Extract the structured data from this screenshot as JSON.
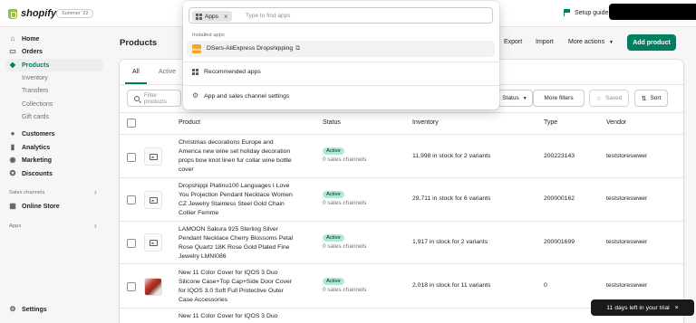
{
  "topbar": {
    "brand": "shopify",
    "edition": "Summer '22",
    "setup_guide": "Setup guide"
  },
  "sidebar": {
    "items": [
      {
        "label": "Home",
        "icon": "home-icon"
      },
      {
        "label": "Orders",
        "icon": "orders-icon"
      },
      {
        "label": "Products",
        "icon": "tag-icon"
      },
      {
        "label": "Customers",
        "icon": "person-icon"
      },
      {
        "label": "Analytics",
        "icon": "analytics-icon"
      },
      {
        "label": "Marketing",
        "icon": "marketing-icon"
      },
      {
        "label": "Discounts",
        "icon": "discount-icon"
      },
      {
        "label": "Online Store",
        "icon": "store-icon"
      },
      {
        "label": "Settings",
        "icon": "gear-icon"
      }
    ],
    "sub_items": [
      "Inventory",
      "Transfers",
      "Collections",
      "Gift cards"
    ],
    "sales_channels_label": "Sales channels",
    "apps_label": "Apps"
  },
  "main": {
    "title": "Products",
    "actions": {
      "export": "Export",
      "import": "Import",
      "more_actions": "More actions",
      "add_product": "Add product"
    },
    "tabs": [
      "All",
      "Active"
    ],
    "filter_placeholder": "Filter products",
    "filter_buttons": {
      "status": "Status",
      "more_filters": "More filters",
      "saved": "Saved",
      "sort": "Sort"
    },
    "columns": [
      "Product",
      "Status",
      "Inventory",
      "Type",
      "Vendor"
    ],
    "rows": [
      {
        "name": "Christmas decorations Europe and America new wine set holiday decoration props bow knot linen fur collar wine bottle cover",
        "status": "Active",
        "channels": "0 sales channels",
        "inventory": "11,998 in stock for 2 variants",
        "type": "200223143",
        "vendor": "teststoreswwer"
      },
      {
        "name": "Dropshippi Platinu100 Languages I Love You Projection Pendant Necklace Women CZ Jewelry Stainless Steel Gold Chain Collier Femme",
        "status": "Active",
        "channels": "0 sales channels",
        "inventory": "29,711 in stock for 6 variants",
        "type": "200000162",
        "vendor": "teststoreswwer"
      },
      {
        "name": "LAMOON Sakura 925 Sterling Silver Pendant Necklace Cherry Blossoms Petal Rose Quartz 18K Rose Gold Plated Fine Jewelry LMNI086",
        "status": "Active",
        "channels": "0 sales channels",
        "inventory": "1,917 in stock for 2 variants",
        "type": "200001699",
        "vendor": "teststoreswwer"
      },
      {
        "name": "New 11 Color Cover for IQOS 3 Duo Silicone Case+Top Cap+Side Door Cover for IQOS 3.0 Soft Full Protective Outer Case Accessories",
        "status": "Active",
        "channels": "0 sales channels",
        "inventory": "2,018 in stock for 11 variants",
        "type": "0",
        "vendor": "teststoreswwer"
      },
      {
        "name": "New 11 Color Cover for IQOS 3 Duo",
        "status": "",
        "channels": "",
        "inventory": "",
        "type": "",
        "vendor": ""
      }
    ]
  },
  "popover": {
    "tag": "Apps",
    "placeholder": "Type to find apps",
    "installed_label": "Installed apps",
    "app_logo_text": "DSers",
    "app_name": "DSers-AliExpress Dropshipping",
    "recommended": "Recommended apps",
    "settings": "App and sales channel settings"
  },
  "trial_banner": "11 days left in your trial",
  "colors": {
    "accent": "#008060",
    "active_badge": "#aee9d1"
  }
}
